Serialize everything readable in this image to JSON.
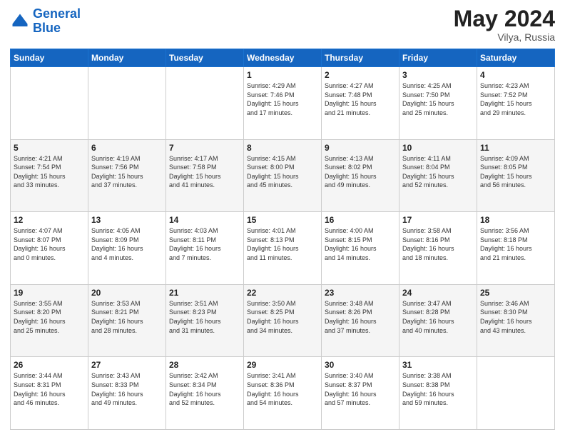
{
  "logo": {
    "line1": "General",
    "line2": "Blue"
  },
  "header": {
    "month_year": "May 2024",
    "location": "Vilya, Russia"
  },
  "weekdays": [
    "Sunday",
    "Monday",
    "Tuesday",
    "Wednesday",
    "Thursday",
    "Friday",
    "Saturday"
  ],
  "weeks": [
    [
      {
        "day": "",
        "info": ""
      },
      {
        "day": "",
        "info": ""
      },
      {
        "day": "",
        "info": ""
      },
      {
        "day": "1",
        "info": "Sunrise: 4:29 AM\nSunset: 7:46 PM\nDaylight: 15 hours\nand 17 minutes."
      },
      {
        "day": "2",
        "info": "Sunrise: 4:27 AM\nSunset: 7:48 PM\nDaylight: 15 hours\nand 21 minutes."
      },
      {
        "day": "3",
        "info": "Sunrise: 4:25 AM\nSunset: 7:50 PM\nDaylight: 15 hours\nand 25 minutes."
      },
      {
        "day": "4",
        "info": "Sunrise: 4:23 AM\nSunset: 7:52 PM\nDaylight: 15 hours\nand 29 minutes."
      }
    ],
    [
      {
        "day": "5",
        "info": "Sunrise: 4:21 AM\nSunset: 7:54 PM\nDaylight: 15 hours\nand 33 minutes."
      },
      {
        "day": "6",
        "info": "Sunrise: 4:19 AM\nSunset: 7:56 PM\nDaylight: 15 hours\nand 37 minutes."
      },
      {
        "day": "7",
        "info": "Sunrise: 4:17 AM\nSunset: 7:58 PM\nDaylight: 15 hours\nand 41 minutes."
      },
      {
        "day": "8",
        "info": "Sunrise: 4:15 AM\nSunset: 8:00 PM\nDaylight: 15 hours\nand 45 minutes."
      },
      {
        "day": "9",
        "info": "Sunrise: 4:13 AM\nSunset: 8:02 PM\nDaylight: 15 hours\nand 49 minutes."
      },
      {
        "day": "10",
        "info": "Sunrise: 4:11 AM\nSunset: 8:04 PM\nDaylight: 15 hours\nand 52 minutes."
      },
      {
        "day": "11",
        "info": "Sunrise: 4:09 AM\nSunset: 8:05 PM\nDaylight: 15 hours\nand 56 minutes."
      }
    ],
    [
      {
        "day": "12",
        "info": "Sunrise: 4:07 AM\nSunset: 8:07 PM\nDaylight: 16 hours\nand 0 minutes."
      },
      {
        "day": "13",
        "info": "Sunrise: 4:05 AM\nSunset: 8:09 PM\nDaylight: 16 hours\nand 4 minutes."
      },
      {
        "day": "14",
        "info": "Sunrise: 4:03 AM\nSunset: 8:11 PM\nDaylight: 16 hours\nand 7 minutes."
      },
      {
        "day": "15",
        "info": "Sunrise: 4:01 AM\nSunset: 8:13 PM\nDaylight: 16 hours\nand 11 minutes."
      },
      {
        "day": "16",
        "info": "Sunrise: 4:00 AM\nSunset: 8:15 PM\nDaylight: 16 hours\nand 14 minutes."
      },
      {
        "day": "17",
        "info": "Sunrise: 3:58 AM\nSunset: 8:16 PM\nDaylight: 16 hours\nand 18 minutes."
      },
      {
        "day": "18",
        "info": "Sunrise: 3:56 AM\nSunset: 8:18 PM\nDaylight: 16 hours\nand 21 minutes."
      }
    ],
    [
      {
        "day": "19",
        "info": "Sunrise: 3:55 AM\nSunset: 8:20 PM\nDaylight: 16 hours\nand 25 minutes."
      },
      {
        "day": "20",
        "info": "Sunrise: 3:53 AM\nSunset: 8:21 PM\nDaylight: 16 hours\nand 28 minutes."
      },
      {
        "day": "21",
        "info": "Sunrise: 3:51 AM\nSunset: 8:23 PM\nDaylight: 16 hours\nand 31 minutes."
      },
      {
        "day": "22",
        "info": "Sunrise: 3:50 AM\nSunset: 8:25 PM\nDaylight: 16 hours\nand 34 minutes."
      },
      {
        "day": "23",
        "info": "Sunrise: 3:48 AM\nSunset: 8:26 PM\nDaylight: 16 hours\nand 37 minutes."
      },
      {
        "day": "24",
        "info": "Sunrise: 3:47 AM\nSunset: 8:28 PM\nDaylight: 16 hours\nand 40 minutes."
      },
      {
        "day": "25",
        "info": "Sunrise: 3:46 AM\nSunset: 8:30 PM\nDaylight: 16 hours\nand 43 minutes."
      }
    ],
    [
      {
        "day": "26",
        "info": "Sunrise: 3:44 AM\nSunset: 8:31 PM\nDaylight: 16 hours\nand 46 minutes."
      },
      {
        "day": "27",
        "info": "Sunrise: 3:43 AM\nSunset: 8:33 PM\nDaylight: 16 hours\nand 49 minutes."
      },
      {
        "day": "28",
        "info": "Sunrise: 3:42 AM\nSunset: 8:34 PM\nDaylight: 16 hours\nand 52 minutes."
      },
      {
        "day": "29",
        "info": "Sunrise: 3:41 AM\nSunset: 8:36 PM\nDaylight: 16 hours\nand 54 minutes."
      },
      {
        "day": "30",
        "info": "Sunrise: 3:40 AM\nSunset: 8:37 PM\nDaylight: 16 hours\nand 57 minutes."
      },
      {
        "day": "31",
        "info": "Sunrise: 3:38 AM\nSunset: 8:38 PM\nDaylight: 16 hours\nand 59 minutes."
      },
      {
        "day": "",
        "info": ""
      }
    ]
  ]
}
